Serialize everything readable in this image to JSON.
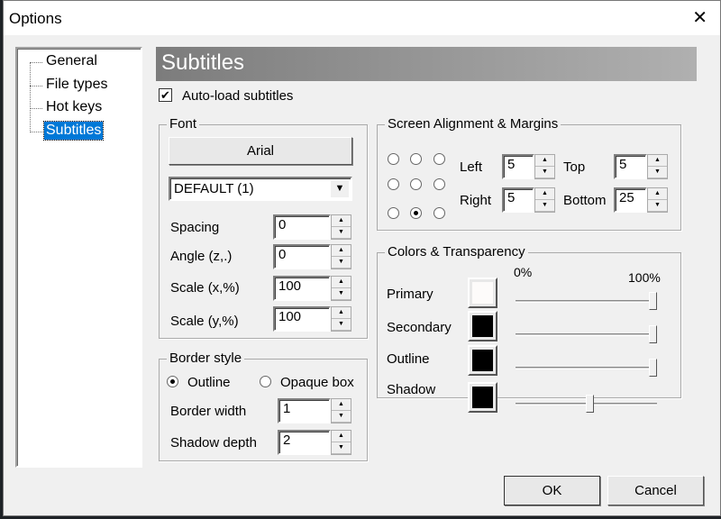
{
  "window": {
    "title": "Options",
    "close": "✕"
  },
  "tree": {
    "items": [
      "General",
      "File types",
      "Hot keys",
      "Subtitles"
    ],
    "selected": "Subtitles"
  },
  "header": "Subtitles",
  "autoload": {
    "label": "Auto-load subtitles",
    "checked": true,
    "mark": "✔"
  },
  "font": {
    "legend": "Font",
    "font_button": "Arial",
    "charset": "DEFAULT (1)",
    "dropdown_arrow": "▼",
    "fields": [
      {
        "label": "Spacing",
        "value": "0"
      },
      {
        "label": "Angle (z,.)",
        "value": "0"
      },
      {
        "label": "Scale (x,%)",
        "value": "100"
      },
      {
        "label": "Scale (y,%)",
        "value": "100"
      }
    ]
  },
  "border": {
    "legend": "Border style",
    "outline": "Outline",
    "opaque": "Opaque box",
    "selected": "Outline",
    "fields": [
      {
        "label": "Border width",
        "value": "1"
      },
      {
        "label": "Shadow depth",
        "value": "2"
      }
    ]
  },
  "alignment": {
    "legend": "Screen Alignment & Margins",
    "selected_position": "bottom-center",
    "left_label": "Left",
    "left": "5",
    "top_label": "Top",
    "top": "5",
    "right_label": "Right",
    "right": "5",
    "bottom_label": "Bottom",
    "bottom": "25"
  },
  "colors": {
    "legend": "Colors & Transparency",
    "min_label": "0%",
    "max_label": "100%",
    "rows": [
      {
        "label": "Primary",
        "color": "#fdfbfa",
        "opacity": 100
      },
      {
        "label": "Secondary",
        "color": "#000000",
        "opacity": 100
      },
      {
        "label": "Outline",
        "color": "#000000",
        "opacity": 100
      },
      {
        "label": "Shadow",
        "color": "#000000",
        "opacity": 53
      }
    ]
  },
  "buttons": {
    "ok": "OK",
    "cancel": "Cancel"
  },
  "spin": {
    "up": "▲",
    "down": "▼"
  }
}
